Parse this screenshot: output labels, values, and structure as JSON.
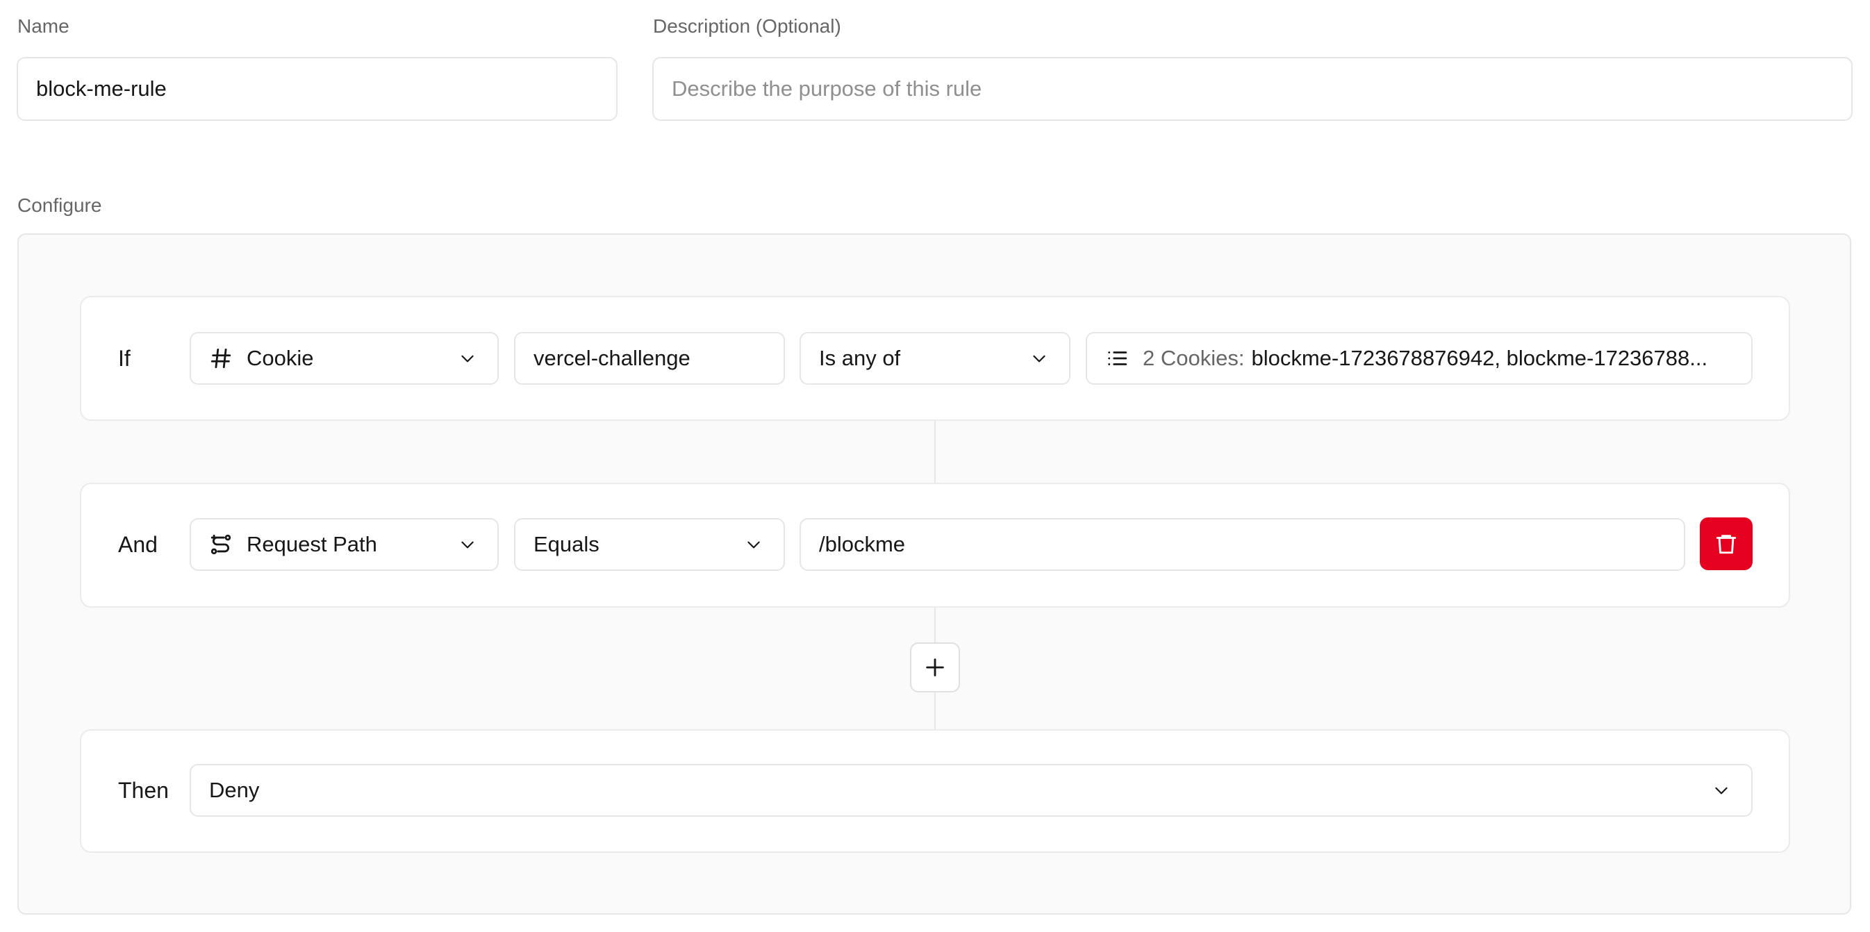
{
  "form": {
    "name_label": "Name",
    "name_value": "block-me-rule",
    "description_label": "Description (Optional)",
    "description_placeholder": "Describe the purpose of this rule",
    "configure_label": "Configure"
  },
  "rules": {
    "if_row": {
      "label": "If",
      "field": "Cookie",
      "field_icon": "hash-icon",
      "key": "vercel-challenge",
      "operator": "Is any of",
      "values_prefix": "2 Cookies:",
      "values_text": "blockme-1723678876942, blockme-17236788..."
    },
    "and_row": {
      "label": "And",
      "field": "Request Path",
      "field_icon": "route-icon",
      "operator": "Equals",
      "value": "/blockme"
    },
    "then_row": {
      "label": "Then",
      "action": "Deny"
    }
  },
  "colors": {
    "danger": "#e5001f",
    "border": "#e6e6e6",
    "panel_bg": "#fafafa"
  }
}
